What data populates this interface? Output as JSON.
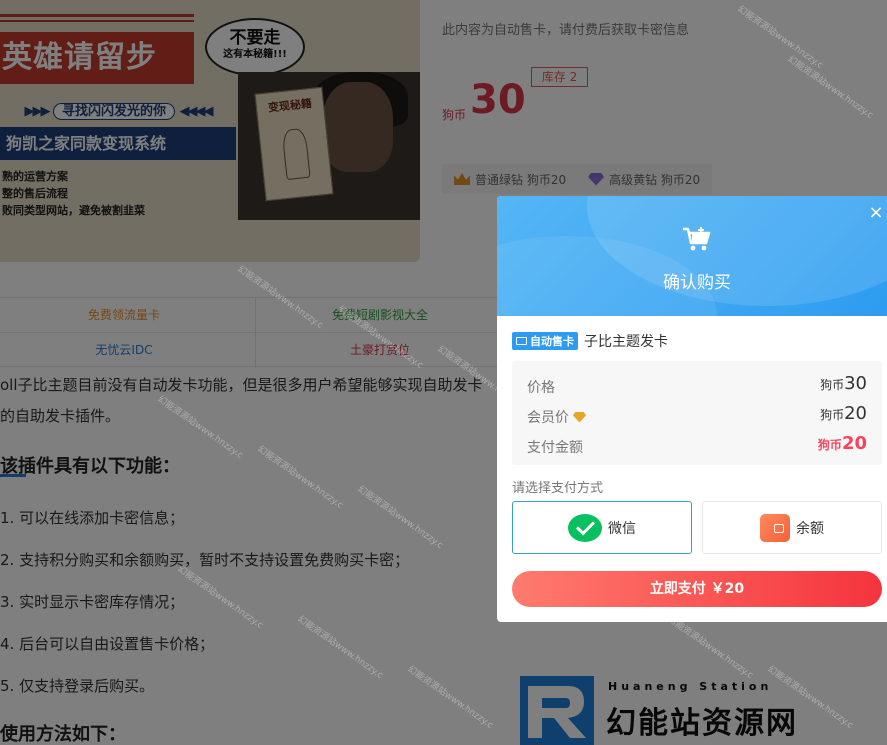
{
  "banner": {
    "hero_text": "英雄请留步",
    "bubble_big": "不要走",
    "bubble_small": "这有本秘籍!!!",
    "seek_text": "寻找闪闪发光的你",
    "bar_text": "狗凯之家同款变现系统",
    "list": [
      "熟的运营方案",
      "整的售后流程",
      "败同类型网站，避免被割韭菜"
    ],
    "book_text": "变现秘籍"
  },
  "product": {
    "description": "此内容为自动售卡，请付费后获取卡密信息",
    "currency_label": "狗币",
    "price": "30",
    "stock": "库存 2",
    "vip_normal": "普通绿钻 狗币20",
    "vip_premium": "高级黄钻 狗币20"
  },
  "links": [
    {
      "label": "免费领流量卡",
      "color": "#e8902a"
    },
    {
      "label": "免费短剧影视大全",
      "color": "#2e9e3e"
    },
    {
      "label": "无忧云IDC",
      "color": "#2b7bd6"
    },
    {
      "label": "土豪打赏位",
      "color": "#d9364a"
    }
  ],
  "article": {
    "para1a": "oll子比主题目前没有自动发卡功能，但是很多用户希望能够实现自助发卡",
    "para1b": "的自助发卡插件。",
    "heading1": "该插件具有以下功能：",
    "items": [
      "1. 可以在线添加卡密信息；",
      "2. 支持积分购买和余额购买，暂时不支持设置免费购买卡密；",
      "3. 实时显示卡密库存情况；",
      "4. 后台可以自由设置售卡价格；",
      "5. 仅支持登录后购买。"
    ],
    "heading2": "使用方法如下："
  },
  "logo": {
    "en": "Huaneng Station",
    "cn": "幻能站资源网"
  },
  "watermark": "幻能资源站www.hnzzy.c",
  "modal": {
    "close_glyph": "×",
    "title": "确认购买",
    "tag_label": "自动售卡",
    "product_name": "子比主题发卡",
    "rows": [
      {
        "label": "价格",
        "unit": "狗币",
        "value": "30"
      },
      {
        "label": "会员价",
        "unit": "狗币",
        "value": "20"
      },
      {
        "label": "支付金额",
        "unit": "狗币",
        "value": "20"
      }
    ],
    "pay_label": "请选择支付方式",
    "pay_wechat": "微信",
    "pay_balance": "余额",
    "submit": "立即支付  ￥20"
  },
  "colors": {
    "accent": "#2d9cf0",
    "price_red": "#d9364a",
    "pay_red": "#f5455e"
  }
}
